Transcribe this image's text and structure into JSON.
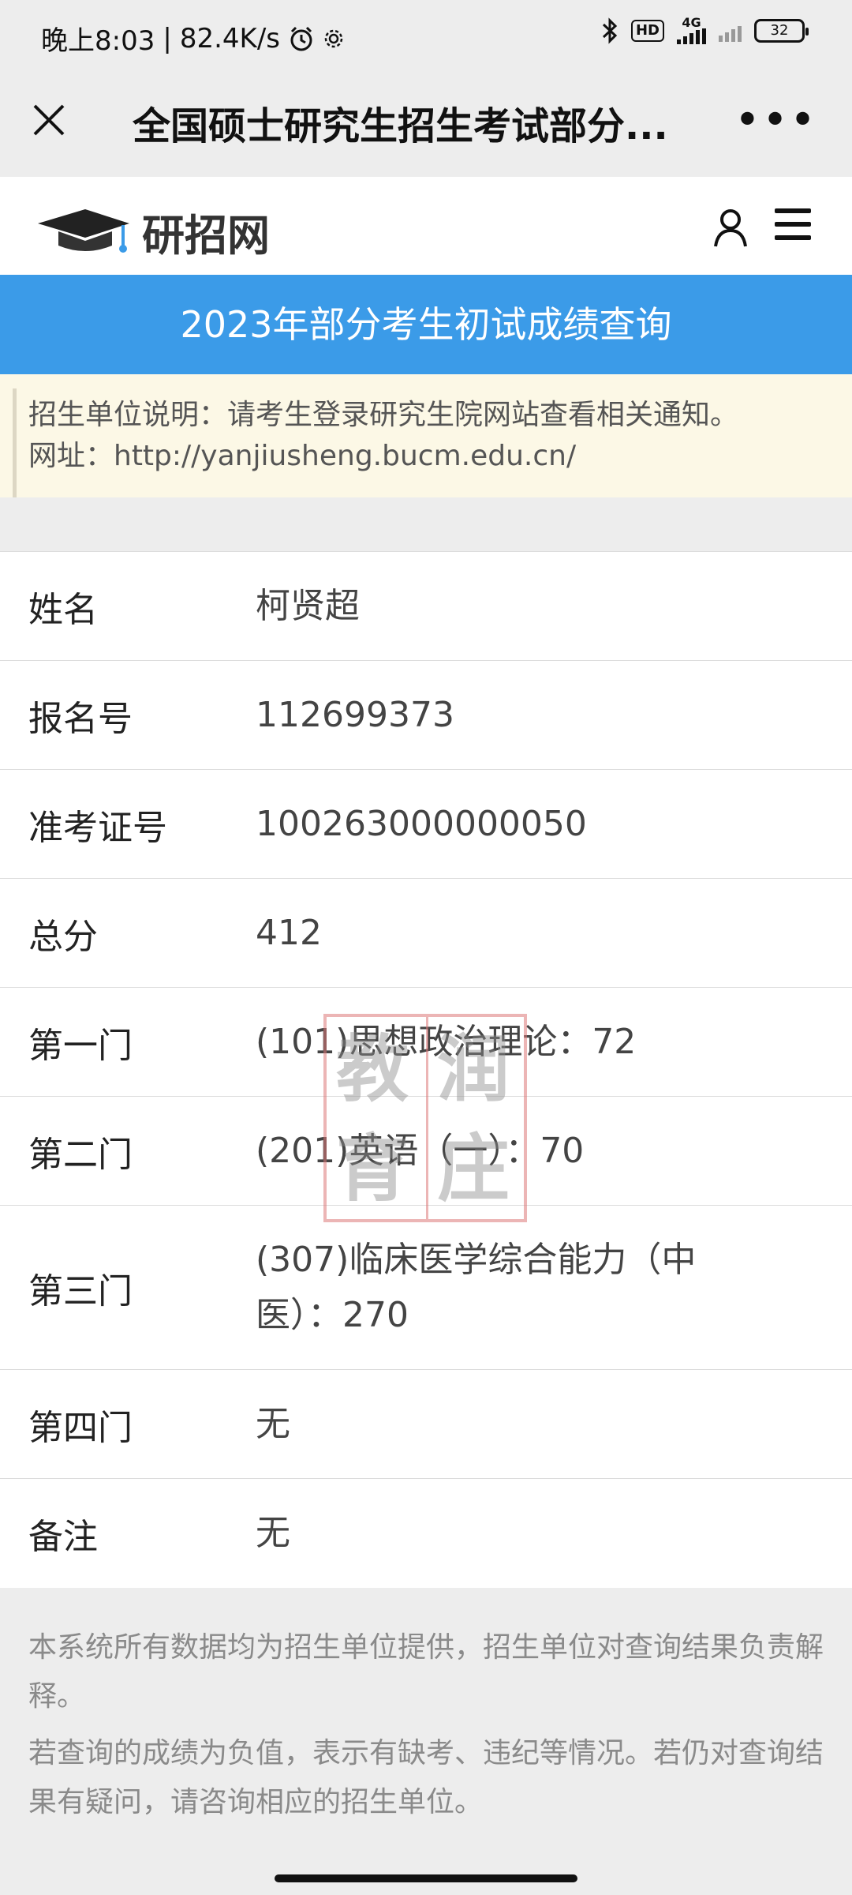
{
  "status_bar": {
    "time": "晚上8:03",
    "separator": "|",
    "speed": "82.4K/s",
    "hd": "HD",
    "network": "4G",
    "battery": "32",
    "icons": [
      "alarm-icon",
      "gear-icon",
      "bluetooth-icon",
      "signal-icon",
      "battery-icon"
    ]
  },
  "title_bar": {
    "close": "✕",
    "title": "全国硕士研究生招生考试部分...",
    "more": "•••"
  },
  "site_header": {
    "logo_text": "研招网"
  },
  "banner": {
    "title": "2023年部分考生初试成绩查询"
  },
  "notice": {
    "line1": "招生单位说明：请考生登录研究生院网站查看相关通知。",
    "line2": "网址：http://yanjiusheng.bucm.edu.cn/"
  },
  "results": [
    {
      "label": "姓名",
      "value": "柯贤超"
    },
    {
      "label": "报名号",
      "value": "112699373"
    },
    {
      "label": "准考证号",
      "value": "100263000000050"
    },
    {
      "label": "总分",
      "value": "412"
    },
    {
      "label": "第一门",
      "value": "(101)思想政治理论：72"
    },
    {
      "label": "第二门",
      "value": "(201)英语（一）：70"
    },
    {
      "label": "第三门",
      "value": "(307)临床医学综合能力（中医）：270"
    },
    {
      "label": "第四门",
      "value": "无"
    },
    {
      "label": "备注",
      "value": "无"
    }
  ],
  "watermark": {
    "chars": [
      "教",
      "润",
      "育",
      "庄"
    ]
  },
  "footer": {
    "note1": "本系统所有数据均为招生单位提供，招生单位对查询结果负责解释。",
    "note2": "若查询的成绩为负值，表示有缺考、违纪等情况。若仍对查询结果有疑问，请咨询相应的招生单位。"
  },
  "colors": {
    "banner": "#3b9be8",
    "notice_bg": "#fcf8e6",
    "page_bg": "#ededed"
  }
}
